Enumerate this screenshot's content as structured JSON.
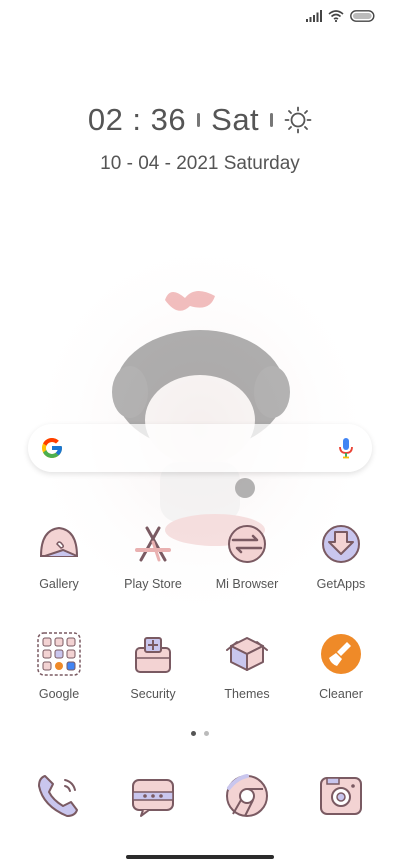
{
  "status": {
    "signal_icon": "signal-bars-icon",
    "wifi_icon": "wifi-icon",
    "battery_icon": "battery-icon"
  },
  "clock": {
    "time": "02 : 36",
    "day": "Sat",
    "weather_icon": "sun-icon",
    "date": "10 - 04 - 2021 Saturday"
  },
  "search": {
    "logo_icon": "google-g-icon",
    "mic_icon": "microphone-icon"
  },
  "apps_row1": [
    {
      "label": "Gallery",
      "icon": "gallery-icon"
    },
    {
      "label": "Play Store",
      "icon": "play-store-icon"
    },
    {
      "label": "Mi Browser",
      "icon": "browser-icon"
    },
    {
      "label": "GetApps",
      "icon": "getapps-icon"
    }
  ],
  "apps_row2": [
    {
      "label": "Google",
      "icon": "google-folder-icon"
    },
    {
      "label": "Security",
      "icon": "security-icon"
    },
    {
      "label": "Themes",
      "icon": "themes-icon"
    },
    {
      "label": "Cleaner",
      "icon": "cleaner-icon"
    }
  ],
  "page_indicator": {
    "pages": 2,
    "current": 1
  },
  "dock": [
    {
      "icon": "phone-icon"
    },
    {
      "icon": "messages-icon"
    },
    {
      "icon": "chrome-icon"
    },
    {
      "icon": "camera-icon"
    }
  ],
  "colors": {
    "icon_pink": "#f3d3d3",
    "icon_lavender": "#c9c6ee",
    "icon_outline": "#7a5a62",
    "cleaner_orange": "#ef8a28",
    "mic_blue": "#4285F4",
    "mic_red": "#EA4335"
  }
}
